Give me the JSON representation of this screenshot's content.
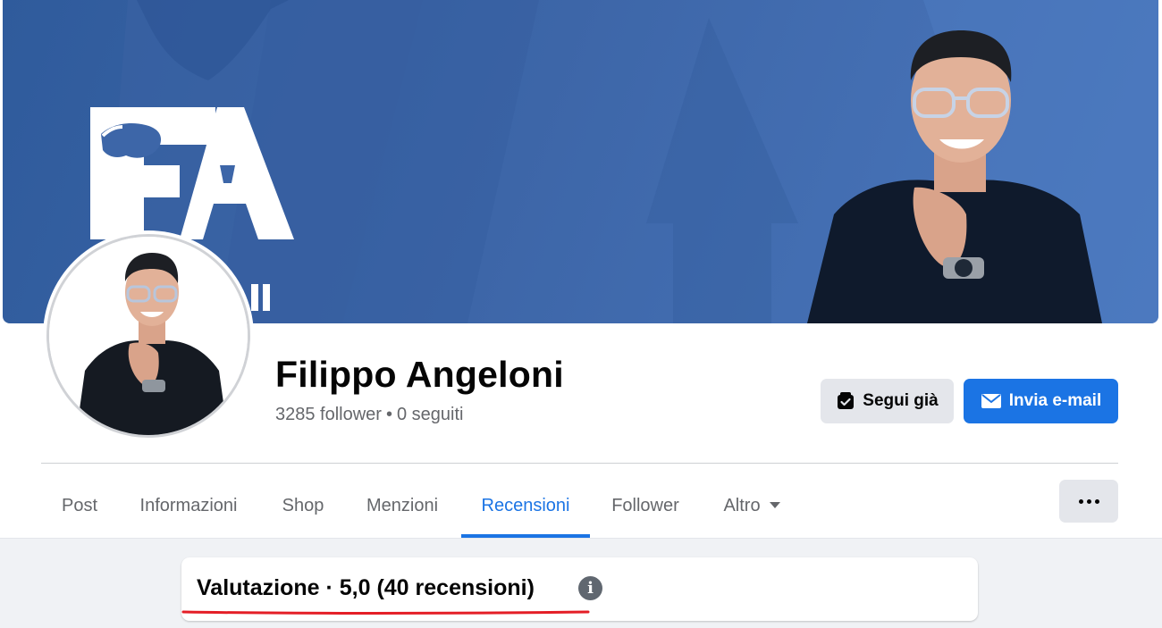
{
  "profile": {
    "name": "Filippo Angeloni",
    "followers": "3285 follower",
    "following": "0 seguiti",
    "separator": "•"
  },
  "cover": {
    "logo_letters": "FA",
    "partial_text": "II",
    "colors": {
      "background": "#3d66a8",
      "logo": "#ffffff"
    }
  },
  "actions": {
    "follow_label": "Segui già",
    "email_label": "Invia e-mail"
  },
  "tabs": [
    {
      "label": "Post",
      "active": false
    },
    {
      "label": "Informazioni",
      "active": false
    },
    {
      "label": "Shop",
      "active": false
    },
    {
      "label": "Menzioni",
      "active": false
    },
    {
      "label": "Recensioni",
      "active": true
    },
    {
      "label": "Follower",
      "active": false
    },
    {
      "label": "Altro",
      "active": false,
      "dropdown": true
    }
  ],
  "more_menu": {
    "icon": "three-dots-icon"
  },
  "reviews": {
    "title": "Valutazione · 5,0 (40 recensioni)",
    "info_icon": "info-icon"
  },
  "colors": {
    "accent": "#1b74e4",
    "secondary_button": "#e4e6eb",
    "muted_text": "#65676b",
    "highlight_underline": "#e41e26"
  }
}
